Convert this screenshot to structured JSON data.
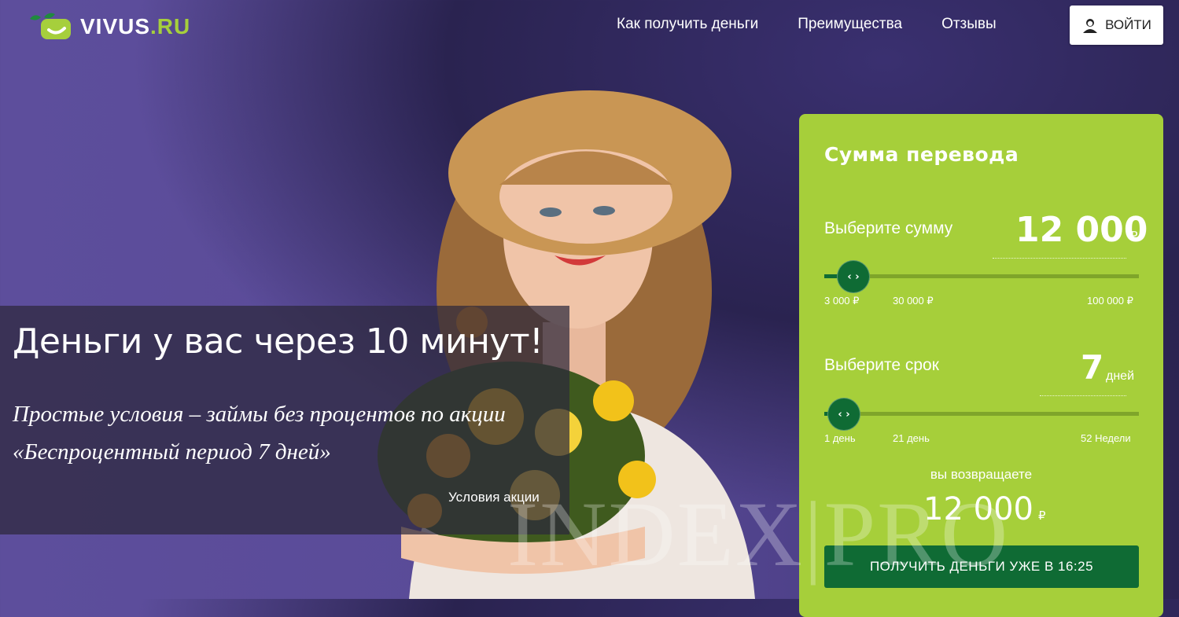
{
  "header": {
    "logo_main": "VIVUS",
    "logo_domain": ".RU",
    "nav": [
      "Как получить деньги",
      "Преимущества",
      "Отзывы"
    ],
    "login_label": "ВОЙТИ"
  },
  "promo": {
    "title": "Деньги у вас через 10 минут!",
    "subtitle": "Простые условия – займы без процентов по акции «Беспроцентный период 7 дней»",
    "conditions_link": "Условия акции"
  },
  "calculator": {
    "title": "Сумма перевода",
    "amount": {
      "label": "Выберите сумму",
      "value": "12 000",
      "currency": "₽",
      "slider_fraction": 0.09,
      "ticks": [
        "3 000 ₽",
        "30 000 ₽",
        "100 000 ₽"
      ]
    },
    "term": {
      "label": "Выберите срок",
      "value": "7",
      "unit": "дней",
      "slider_fraction": 0.06,
      "ticks": [
        "1 день",
        "21 день",
        "52 Недели"
      ]
    },
    "return_label": "вы возвращаете",
    "return_value": "12 000",
    "return_currency": "₽",
    "submit_label": "ПОЛУЧИТЬ ДЕНЬГИ УЖЕ В 16:25"
  },
  "watermark": "INDEX|PRO",
  "colors": {
    "background": "#5a4b98",
    "panel_green": "#a6cf3a",
    "dark_green": "#0f6b34",
    "logo_green": "#a6cf3c"
  }
}
